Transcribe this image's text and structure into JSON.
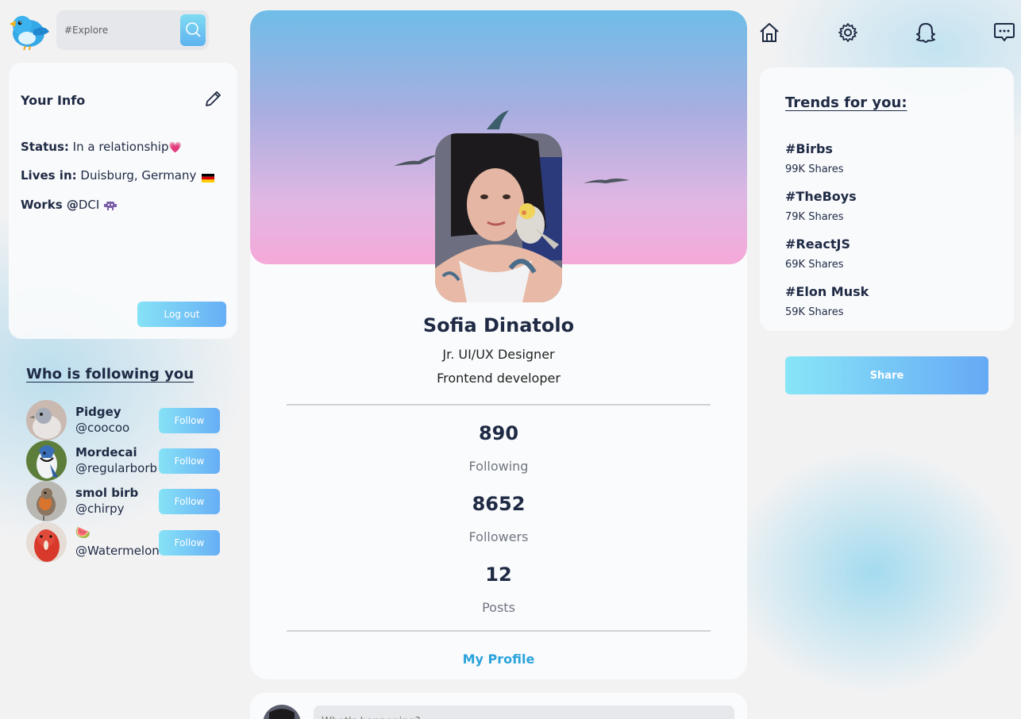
{
  "search": {
    "placeholder": "#Explore"
  },
  "info": {
    "title": "Your Info",
    "status_label": "Status:",
    "status_value": "In a relationship",
    "status_emoji": "💗",
    "lives_label": "Lives in:",
    "lives_value": "Duisburg, Germany",
    "lives_emoji": "🇩🇪",
    "works_label": "Works @",
    "works_value": "DCI",
    "works_emoji": "👾",
    "logout_label": "Log out"
  },
  "followers": {
    "title": "Who is following you",
    "items": [
      {
        "name": "Pidgey",
        "handle": "@coocoo",
        "button": "Follow"
      },
      {
        "name": "Mordecai",
        "handle": "@regularborb",
        "button": "Follow"
      },
      {
        "name": "smol birb",
        "handle": "@chirpy",
        "button": "Follow"
      },
      {
        "name": "🍉",
        "handle": "@Watermelon",
        "button": "Follow"
      }
    ]
  },
  "profile": {
    "name": "Sofia Dinatolo",
    "title1": "Jr. UI/UX Designer",
    "title2": "Frontend developer",
    "stats": [
      {
        "value": "890",
        "label": "Following"
      },
      {
        "value": "8652",
        "label": "Followers"
      },
      {
        "value": "12",
        "label": "Posts"
      }
    ],
    "link": "My Profile"
  },
  "post": {
    "placeholder": "What's happening?"
  },
  "nav": {
    "icons": [
      "home-icon",
      "gear-icon",
      "snapchat-ghost-icon",
      "message-icon"
    ]
  },
  "trends": {
    "title": "Trends for you:",
    "items": [
      {
        "tag": "#Birbs",
        "shares": "99K Shares"
      },
      {
        "tag": "#TheBoys",
        "shares": "79K Shares"
      },
      {
        "tag": "#ReactJS",
        "shares": "69K Shares"
      },
      {
        "tag": "#Elon Musk",
        "shares": "59K Shares"
      }
    ]
  },
  "share": {
    "label": "Share"
  },
  "colors": {
    "accent": "#2aa3dc",
    "button_start": "#86e2f6",
    "button_end": "#67aef5",
    "text_dark": "#1f2a44"
  }
}
